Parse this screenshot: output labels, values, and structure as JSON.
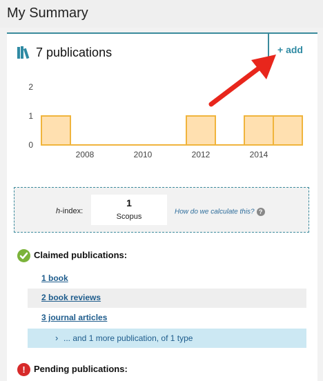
{
  "header": {
    "title": "My Summary"
  },
  "summary": {
    "publications_label": "7 publications",
    "add_label": "+ add"
  },
  "chart_data": {
    "type": "bar",
    "x": [
      2007,
      2008,
      2009,
      2010,
      2011,
      2012,
      2013,
      2014,
      2015
    ],
    "values": [
      1,
      0,
      0,
      0,
      0,
      1,
      0,
      1,
      1
    ],
    "xticks": [
      "2008",
      "2010",
      "2012",
      "2014"
    ],
    "ylim": [
      0,
      2
    ],
    "yticks": [
      "0",
      "1",
      "2"
    ],
    "bar_color": "#ffe0b0",
    "bar_edge": "#f0b43c"
  },
  "hindex": {
    "label_prefix": "h",
    "label_suffix": "-index:",
    "value": "1",
    "source": "Scopus",
    "calc_link": "How do we calculate this?",
    "help_glyph": "?"
  },
  "claimed": {
    "title": "Claimed publications:",
    "items": [
      "1 book",
      "2 book reviews",
      "3 journal articles"
    ],
    "more": "... and 1 more publication, of 1 type",
    "more_chevron": "›"
  },
  "pending": {
    "title": "Pending publications:",
    "glyph": "!"
  },
  "colors": {
    "accent": "#3a8a9c",
    "link": "#1e5c8c",
    "claimed": "#7bb33a",
    "pending": "#d72a2a",
    "arrow": "#e8261c"
  }
}
